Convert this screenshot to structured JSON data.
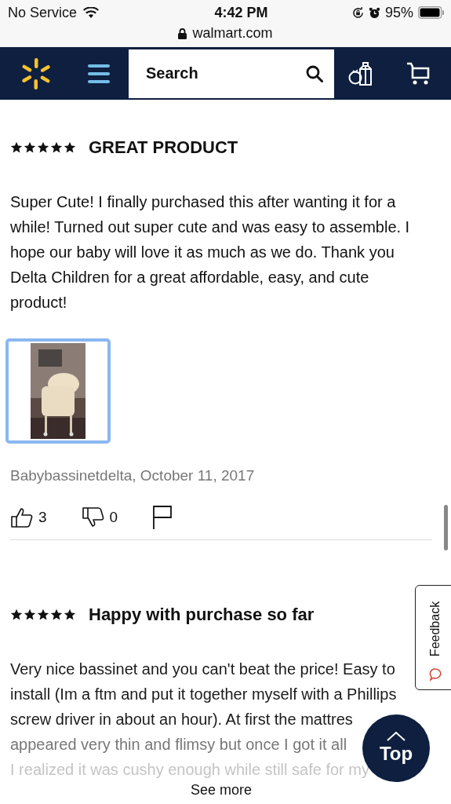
{
  "status_bar": {
    "carrier": "No Service",
    "time": "4:42 PM",
    "battery": "95%",
    "url": "walmart.com"
  },
  "nav": {
    "search": {
      "placeholder": "Search"
    }
  },
  "reviews": [
    {
      "stars": 5,
      "title": "GREAT PRODUCT",
      "body": [
        "Super Cute! I finally purchased this after wanting it for a while! Turned out super cute and was easy to assemble. I hope our baby will love it as much as we do. Thank you Delta Children for a great affordable, easy, and cute product!"
      ],
      "photo": {
        "kind": "picture",
        "selected": true
      },
      "author": "Babybassinetdelta, October 11, 2017",
      "helpful": "3",
      "unhelpful": "0"
    },
    {
      "stars": 5,
      "title": "Happy with purchase so far",
      "body": [
        "Very nice bassinet and you can't beat the price! Easy to",
        "install (Im a ftm and put it together myself with a Phillips",
        "screw driver in about an hour). At first the mattres",
        "appeared very thin and flimsy but once I got it all",
        "I realized it was cushy enough while still safe for my"
      ],
      "more": "See more"
    }
  ],
  "feedback": "Feedback",
  "top_button": "Top"
}
